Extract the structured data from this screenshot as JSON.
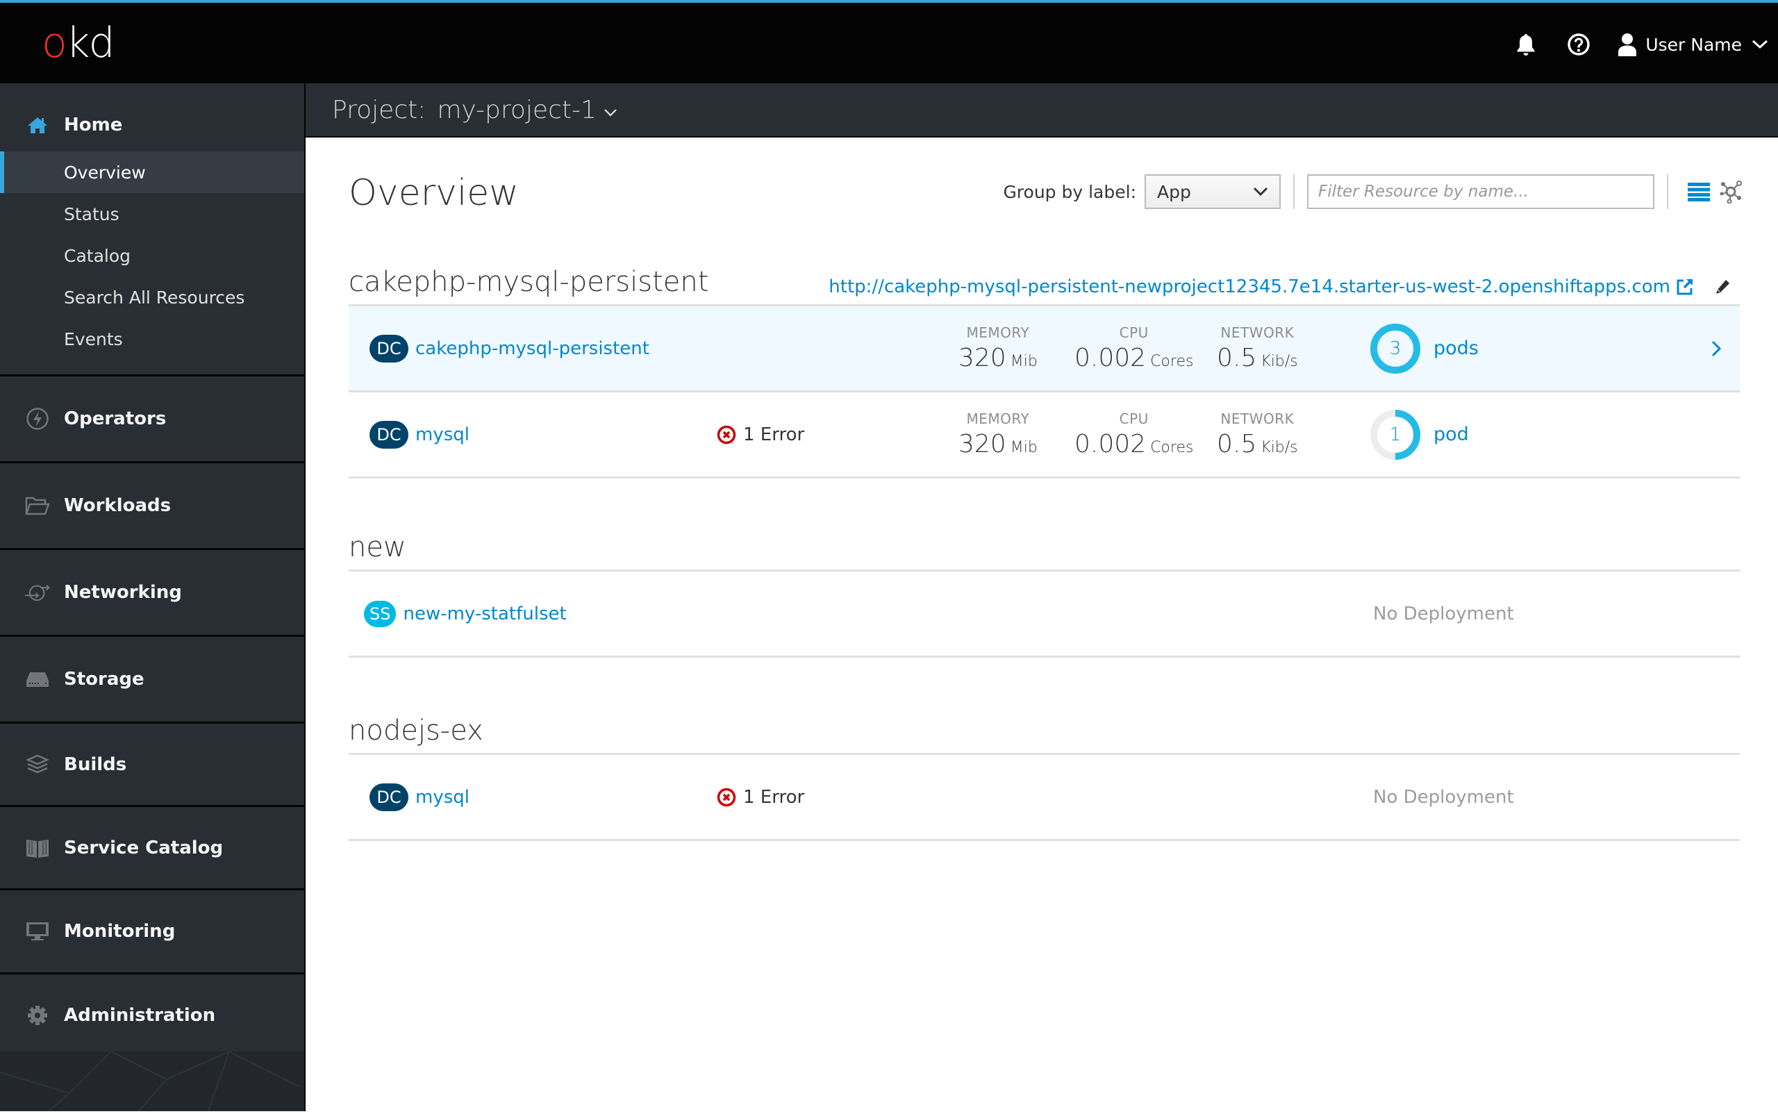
{
  "masthead": {
    "logo_prefix": "o",
    "logo_rest": "kd",
    "notifications_icon": "bell-icon",
    "help_icon": "question-circle-icon",
    "user_icon": "user-icon",
    "user_name": "User Name",
    "accent_color": "#39a5dc"
  },
  "sidebar": {
    "home": {
      "label": "Home",
      "icon": "home-icon",
      "items": [
        {
          "label": "Overview",
          "active": true
        },
        {
          "label": "Status"
        },
        {
          "label": "Catalog"
        },
        {
          "label": "Search All Resources"
        },
        {
          "label": "Events"
        }
      ]
    },
    "sections": [
      {
        "label": "Operators",
        "icon": "bolt-circle-icon"
      },
      {
        "label": "Workloads",
        "icon": "folder-open-icon"
      },
      {
        "label": "Networking",
        "icon": "network-icon"
      },
      {
        "label": "Storage",
        "icon": "storage-icon"
      },
      {
        "label": "Builds",
        "icon": "layers-icon"
      },
      {
        "label": "Service Catalog",
        "icon": "book-icon"
      },
      {
        "label": "Monitoring",
        "icon": "monitor-icon"
      },
      {
        "label": "Administration",
        "icon": "gear-icon"
      }
    ]
  },
  "project_bar": {
    "label": "Project:",
    "name": "my-project-1"
  },
  "overview": {
    "title": "Overview",
    "group_by_label": "Group by label:",
    "group_by_value": "App",
    "filter_placeholder": "Filter Resource by name...",
    "groups": [
      {
        "title": "cakephp-mysql-persistent",
        "route_url": "http://cakephp-mysql-persistent-newproject12345.7e14.starter-us-west-2.openshiftapps.com",
        "rows": [
          {
            "kind": "DC",
            "name": "cakephp-mysql-persistent",
            "selected": true,
            "metrics": {
              "memory_label": "MEMORY",
              "memory_value": "320",
              "memory_unit": "Mib",
              "cpu_label": "CPU",
              "cpu_value": "0.002",
              "cpu_unit": "Cores",
              "network_label": "NETWORK",
              "network_value": "0.5",
              "network_unit": "Kib/s"
            },
            "pods": {
              "count": "3",
              "label": "pods",
              "fill_fraction": 1.0
            }
          },
          {
            "kind": "DC",
            "name": "mysql",
            "alert": "1 Error",
            "metrics": {
              "memory_label": "MEMORY",
              "memory_value": "320",
              "memory_unit": "Mib",
              "cpu_label": "CPU",
              "cpu_value": "0.002",
              "cpu_unit": "Cores",
              "network_label": "NETWORK",
              "network_value": "0.5",
              "network_unit": "Kib/s"
            },
            "pods": {
              "count": "1",
              "label": "pod",
              "fill_fraction": 0.5
            }
          }
        ]
      },
      {
        "title": "new",
        "rows": [
          {
            "kind": "SS",
            "name": "new-my-statfulset",
            "status": "No Deployment"
          }
        ]
      },
      {
        "title": "nodejs-ex",
        "rows": [
          {
            "kind": "DC",
            "name": "mysql",
            "alert": "1 Error",
            "status": "No Deployment"
          }
        ]
      }
    ]
  },
  "colors": {
    "link": "#0088ce",
    "dc_badge": "#004368",
    "ss_badge": "#00b9e4",
    "donut": "#25bbe7",
    "error": "#cc0000",
    "selected_row": "#f0f9ff"
  }
}
